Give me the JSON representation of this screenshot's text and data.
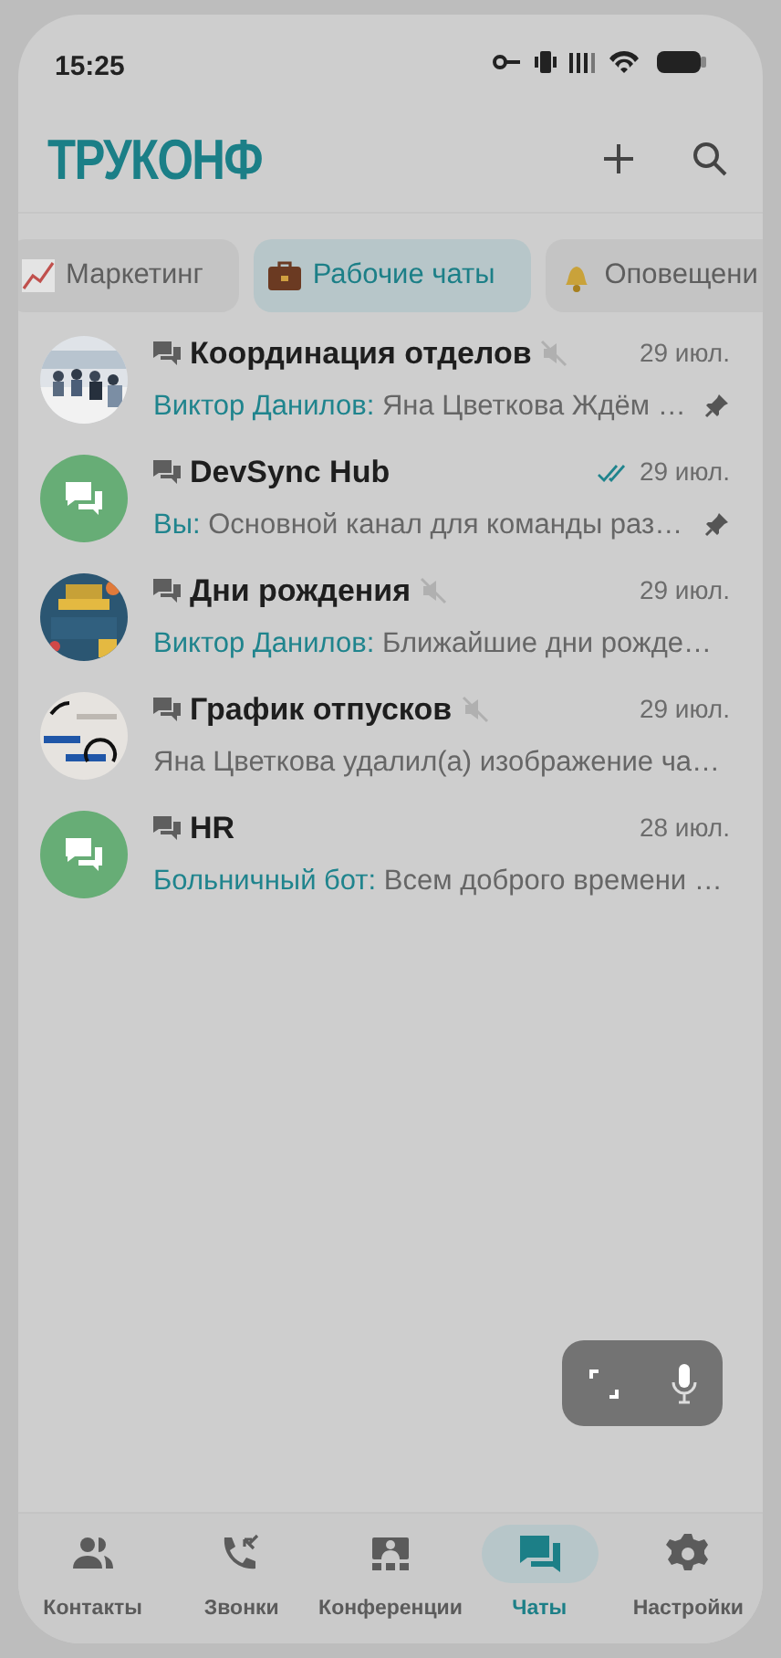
{
  "status_bar": {
    "time": "15:25"
  },
  "header": {
    "logo": "ТРУКОНФ"
  },
  "folders": [
    {
      "label": "Маркетинг",
      "selected": false
    },
    {
      "label": "Рабочие чаты",
      "selected": true
    },
    {
      "label": "Оповещени",
      "selected": false
    }
  ],
  "chats": [
    {
      "kind": "picture",
      "title": "Координация отделов",
      "muted": true,
      "date": "29 июл.",
      "read": false,
      "sender": "Виктор Данилов:",
      "message": "Яна Цветкова Ждём …",
      "pinned": true
    },
    {
      "kind": "group",
      "title": "DevSync Hub",
      "muted": false,
      "date": "29 июл.",
      "read": true,
      "sender": "Вы:",
      "message": "Основной канал для команды раз…",
      "pinned": true
    },
    {
      "kind": "picture",
      "title": "Дни рождения",
      "muted": true,
      "date": "29 июл.",
      "read": false,
      "sender": "Виктор Данилов:",
      "message": "Ближайшие дни рожде…",
      "pinned": false
    },
    {
      "kind": "picture",
      "title": "График отпусков",
      "muted": true,
      "date": "29 июл.",
      "read": false,
      "message": "Яна Цветкова удалил(а) изображение ча…",
      "pinned": false
    },
    {
      "kind": "group",
      "title": "HR",
      "muted": false,
      "date": "28 июл.",
      "read": false,
      "sender": "Больничный бот:",
      "message": "Всем доброго времени …",
      "pinned": false
    }
  ],
  "bottom_nav": [
    {
      "label": "Контакты",
      "selected": false
    },
    {
      "label": "Звонки",
      "selected": false
    },
    {
      "label": "Конференции",
      "selected": false
    },
    {
      "label": "Чаты",
      "selected": true
    },
    {
      "label": "Настройки",
      "selected": false
    }
  ]
}
